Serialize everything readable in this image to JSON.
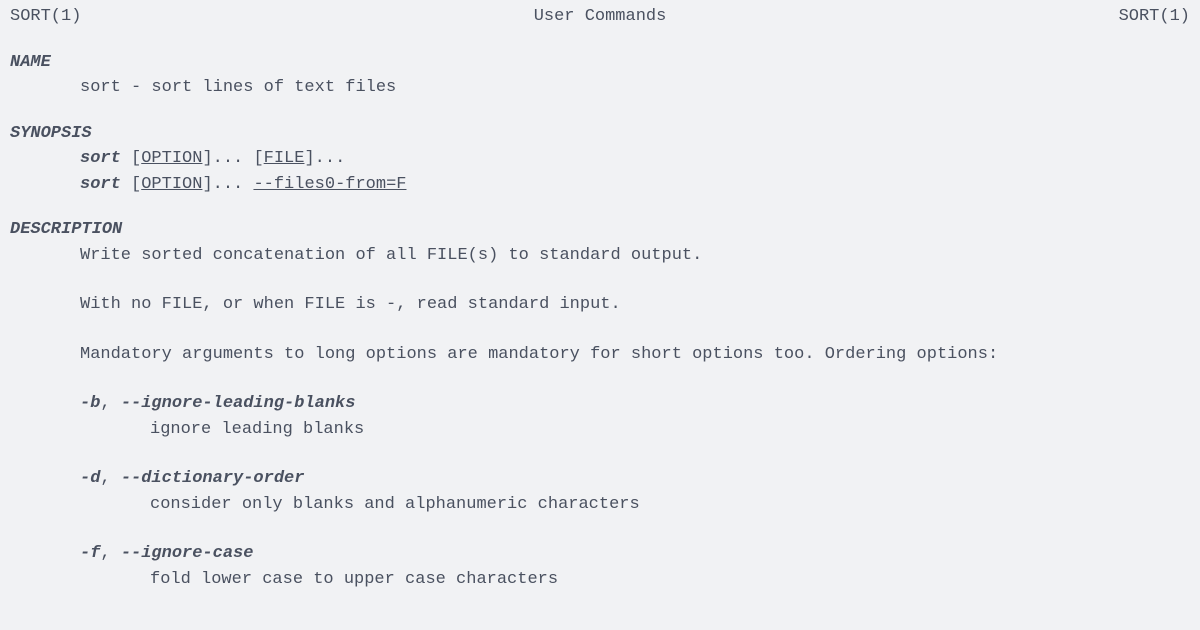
{
  "header": {
    "left": "SORT(1)",
    "center": "User Commands",
    "right": "SORT(1)"
  },
  "sections": {
    "name_head": "NAME",
    "name_text": "sort - sort lines of text files",
    "synopsis_head": "SYNOPSIS",
    "synopsis": {
      "line1": {
        "cmd": "sort",
        "open1": " [",
        "arg1": "OPTION",
        "dots1": "]... [",
        "arg2": "FILE",
        "close2": "]..."
      },
      "line2": {
        "cmd": "sort",
        "open1": " [",
        "arg1": "OPTION",
        "dots1": "]... ",
        "arg2": "--files0-from=F"
      }
    },
    "description_head": "DESCRIPTION",
    "description_p1": "Write sorted concatenation of all FILE(s) to standard output.",
    "description_p2": "With no FILE, or when FILE is -, read standard input.",
    "description_p3": "Mandatory arguments to long options are mandatory for short options too.  Ordering options:",
    "options": [
      {
        "short": "-b",
        "sep": ", ",
        "long": "--ignore-leading-blanks",
        "desc": "ignore leading blanks"
      },
      {
        "short": "-d",
        "sep": ", ",
        "long": "--dictionary-order",
        "desc": "consider only blanks and alphanumeric characters"
      },
      {
        "short": "-f",
        "sep": ", ",
        "long": "--ignore-case",
        "desc": "fold lower case to upper case characters"
      }
    ]
  }
}
